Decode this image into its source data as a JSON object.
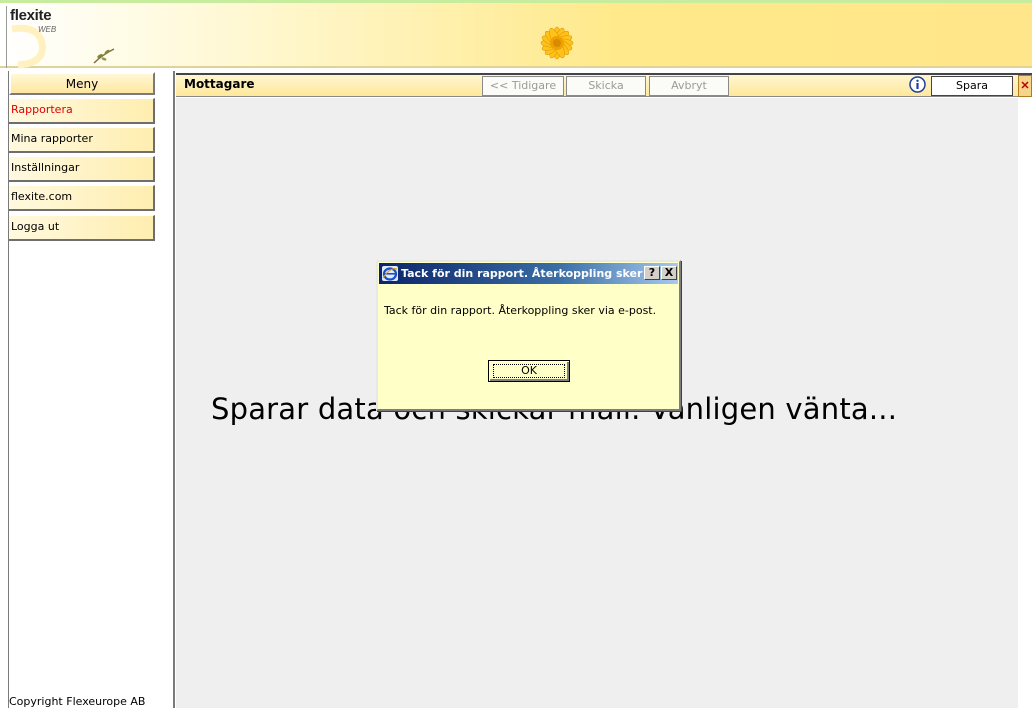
{
  "header": {
    "logo_text": "flexite",
    "logo_sub": "WEB"
  },
  "sidebar": {
    "title": "Meny",
    "items": [
      {
        "label": "Rapportera",
        "active": true
      },
      {
        "label": "Mina rapporter",
        "active": false
      },
      {
        "label": "Inställningar",
        "active": false
      },
      {
        "label": "flexite.com",
        "active": false
      },
      {
        "label": "Logga ut",
        "active": false
      }
    ],
    "copyright": "Copyright Flexeurope AB"
  },
  "toolbar": {
    "title": "Mottagare",
    "prev_label": "<< Tidigare",
    "send_label": "Skicka",
    "cancel_label": "Avbryt",
    "save_label": "Spara"
  },
  "content": {
    "wait_message": "Sparar data och skickar mail. Vänligen vänta..."
  },
  "dialog": {
    "title": "Tack för din rapport. Återkoppling sker v...",
    "message": "Tack för din rapport. Återkoppling sker via e-post.",
    "help_label": "?",
    "close_label": "X",
    "ok_label": "OK"
  },
  "colors": {
    "active_menu": "#e00000",
    "dialog_bg": "#ffffc8",
    "titlebar": "#0a246a",
    "header_accent": "#ffe68a"
  }
}
